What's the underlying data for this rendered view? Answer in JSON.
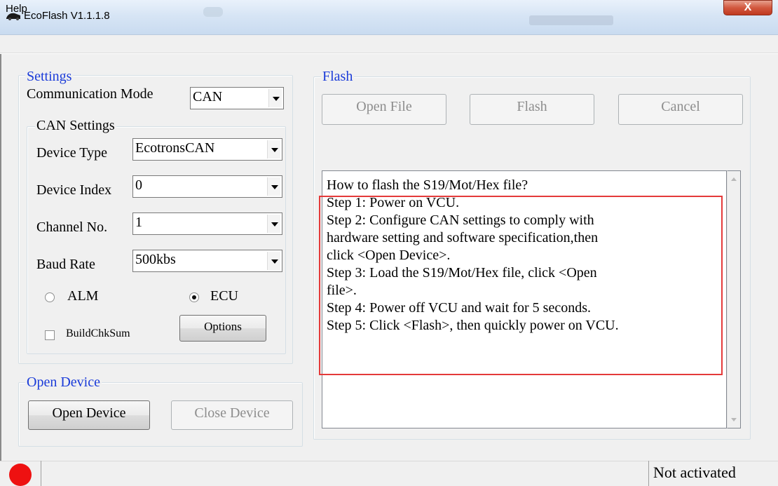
{
  "window": {
    "title": "EcoFlash V1.1.1.8",
    "close_glyph": "X"
  },
  "menu": {
    "help": "Help"
  },
  "settings": {
    "legend": "Settings",
    "comm_mode_label": "Communication Mode",
    "comm_mode_value": "CAN",
    "can_settings_legend": "CAN Settings",
    "device_type_label": "Device Type",
    "device_type_value": "EcotronsCAN",
    "device_index_label": "Device Index",
    "device_index_value": "0",
    "channel_label": "Channel No.",
    "channel_value": "1",
    "baud_label": "Baud Rate",
    "baud_value": "500kbs",
    "radio_alm": "ALM",
    "radio_ecu": "ECU",
    "radio_selected": "ECU",
    "build_checksum": "BuildChkSum",
    "build_checksum_checked": false,
    "options_button": "Options"
  },
  "open_device": {
    "legend": "Open Device",
    "open_button": "Open Device",
    "close_button": "Close Device"
  },
  "flash": {
    "legend": "Flash",
    "open_file_button": "Open File",
    "flash_button": "Flash",
    "cancel_button": "Cancel",
    "instructions": [
      "How to flash the S19/Mot/Hex file?",
      "Step 1: Power on VCU.",
      "Step 2: Configure CAN settings to comply with",
      "hardware setting and software specification,then",
      "click <Open Device>.",
      "Step 3: Load the S19/Mot/Hex file, click <Open",
      "file>.",
      "Step 4: Power off VCU and wait for 5 seconds.",
      "Step 5: Click <Flash>, then quickly power on VCU."
    ]
  },
  "status": {
    "led_color": "#ee1111",
    "text": "Not activated"
  },
  "icons": {
    "app": "car-icon",
    "close": "close-icon",
    "dropdown": "chevron-down-icon"
  },
  "colors": {
    "legend_blue": "#1a3bd9",
    "highlight_red": "#e43a3a"
  }
}
